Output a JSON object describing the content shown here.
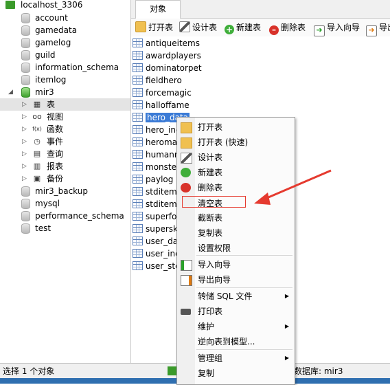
{
  "tree": {
    "connection": "localhost_3306",
    "databases_top": [
      "account",
      "gamedata",
      "gamelog",
      "guild",
      "information_schema",
      "itemlog"
    ],
    "open_db": "mir3",
    "children": [
      {
        "icon": "table-icon",
        "label": "表"
      },
      {
        "icon": "view-icon",
        "label": "视图"
      },
      {
        "icon": "function-icon",
        "label": "函数"
      },
      {
        "icon": "event-icon",
        "label": "事件"
      },
      {
        "icon": "query-icon",
        "label": "查询"
      },
      {
        "icon": "report-icon",
        "label": "报表"
      },
      {
        "icon": "backup-icon",
        "label": "备份"
      }
    ],
    "databases_bottom": [
      "mir3_backup",
      "mysql",
      "performance_schema",
      "test"
    ]
  },
  "tabs": {
    "object": "对象"
  },
  "toolbar": {
    "open_table": "打开表",
    "design_table": "设计表",
    "new_table": "新建表",
    "delete_table": "删除表",
    "import_wizard": "导入向导",
    "export_wizard": "导出"
  },
  "tables": [
    "antiqueitems",
    "awardplayers",
    "dominatorpet",
    "fieldhero",
    "forcemagic",
    "halloffame",
    "hero_data",
    "hero_ind",
    "heroma",
    "humann",
    "monster",
    "paylog",
    "stditems",
    "stditems",
    "superfo",
    "supersk",
    "user_dat",
    "user_ind",
    "user_stc"
  ],
  "selected_table": "hero_data",
  "context_menu": {
    "open_table": "打开表",
    "open_table_fast": "打开表 (快速)",
    "design_table": "设计表",
    "new_table": "新建表",
    "delete_table": "删除表",
    "empty_table": "清空表",
    "truncate_table": "截断表",
    "copy_table": "复制表",
    "set_permissions": "设置权限",
    "import_wizard": "导入向导",
    "export_wizard": "导出向导",
    "dump_sql": "转储 SQL 文件",
    "print_table": "打印表",
    "maintenance": "维护",
    "reverse_to_model": "逆向表到模型...",
    "manage_group": "管理组",
    "copy": "复制"
  },
  "status": {
    "left": "选择 1 个对象",
    "right": "数据库: mir3"
  },
  "colors": {
    "annotation_red": "#e53a2f",
    "selection_blue": "#3b7bd6"
  }
}
